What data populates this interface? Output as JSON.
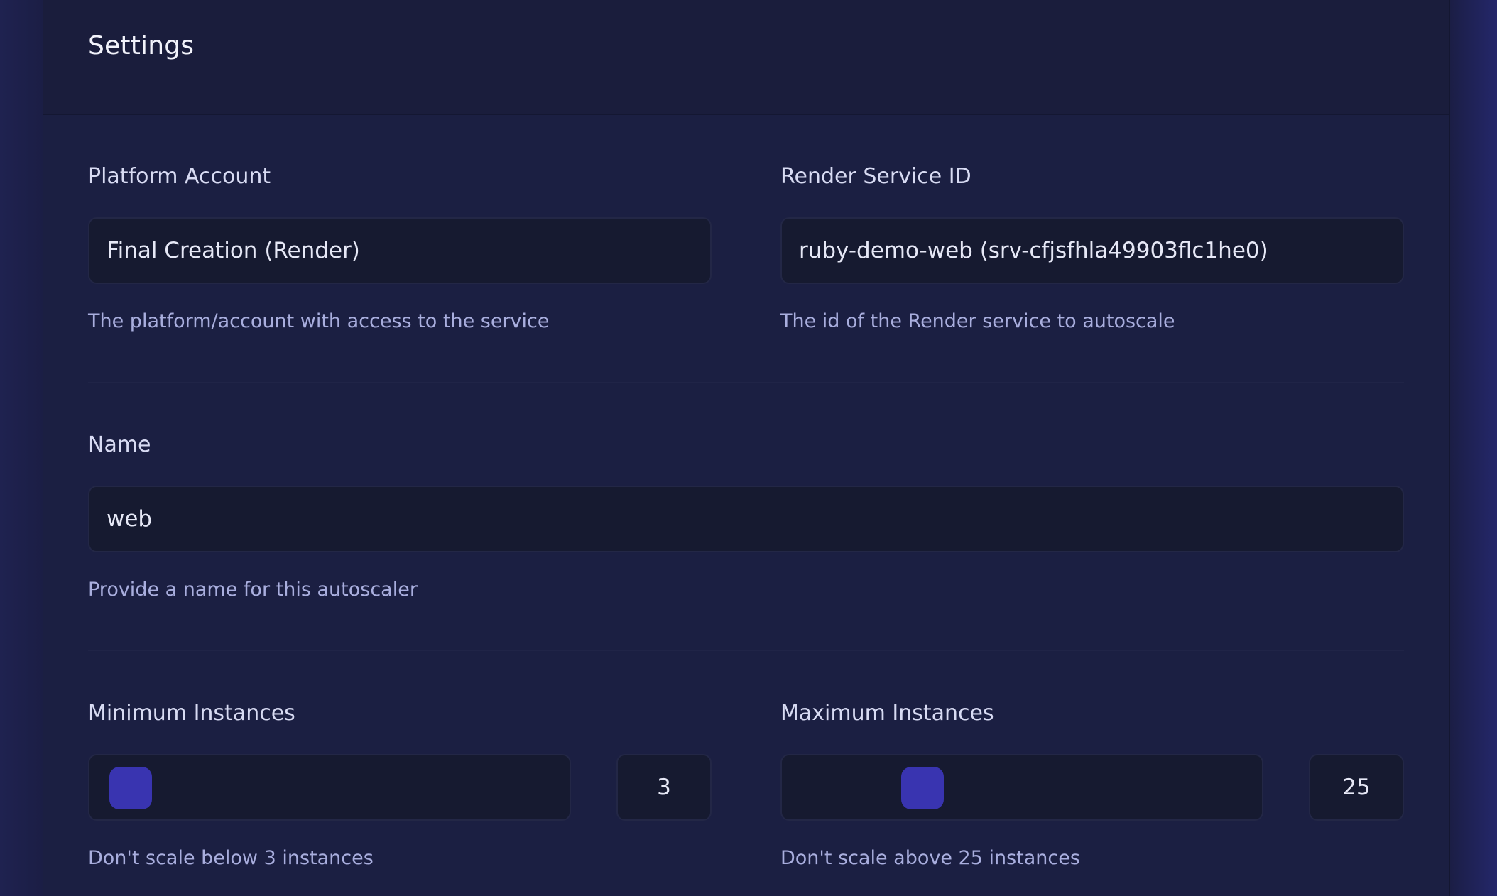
{
  "header": {
    "title": "Settings"
  },
  "fields": {
    "platform_account": {
      "label": "Platform Account",
      "value": "Final Creation (Render)",
      "help": "The platform/account with access to the service"
    },
    "render_service_id": {
      "label": "Render Service ID",
      "value": "ruby-demo-web (srv-cfjsfhla49903flc1he0)",
      "help": "The id of the Render service to autoscale"
    },
    "name": {
      "label": "Name",
      "value": "web",
      "help": "Provide a name for this autoscaler"
    },
    "minimum_instances": {
      "label": "Minimum Instances",
      "value": "3",
      "help": "Don't scale below 3 instances",
      "slider_fraction": 0.0
    },
    "maximum_instances": {
      "label": "Maximum Instances",
      "value": "25",
      "help": "Don't scale above 25 instances",
      "slider_fraction": 0.25
    }
  },
  "colors": {
    "accent": "#3934b0",
    "panel_bg": "#1b1f42",
    "input_bg": "#161a30"
  }
}
